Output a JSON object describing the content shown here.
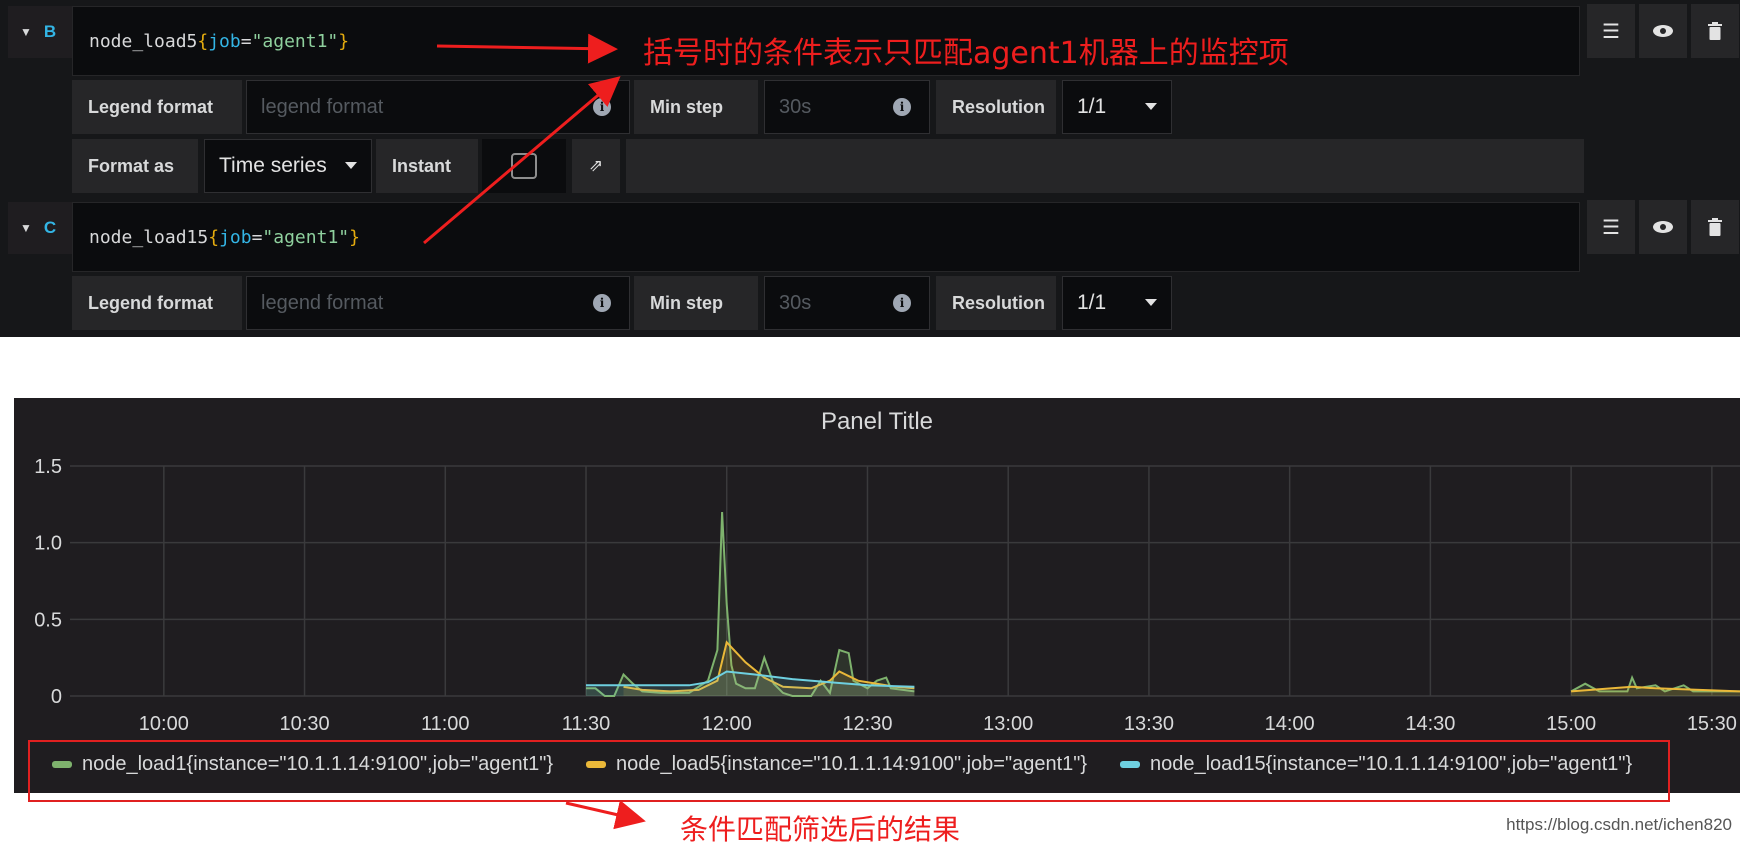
{
  "query_b": {
    "label": "B",
    "expr": {
      "metric": "node_load5",
      "open": "{",
      "key": "job",
      "eq": "=",
      "value": "\"agent1\"",
      "close": "}"
    },
    "legend_format_label": "Legend format",
    "legend_format_placeholder": "legend format",
    "min_step_label": "Min step",
    "min_step_placeholder": "30s",
    "resolution_label": "Resolution",
    "resolution_value": "1/1",
    "format_as_label": "Format as",
    "format_as_value": "Time series",
    "instant_label": "Instant"
  },
  "query_c": {
    "label": "C",
    "expr": {
      "metric": "node_load15",
      "open": "{",
      "key": "job",
      "eq": "=",
      "value": "\"agent1\"",
      "close": "}"
    },
    "legend_format_label": "Legend format",
    "legend_format_placeholder": "legend format",
    "min_step_label": "Min step",
    "min_step_placeholder": "30s",
    "resolution_label": "Resolution",
    "resolution_value": "1/1"
  },
  "icons": {
    "menu": "hamburger-icon",
    "toggle": "eye-icon",
    "remove": "trash-icon",
    "share": "share-icon",
    "info": "info-icon",
    "collapse": "caret-down-icon"
  },
  "annotations": {
    "top": "括号时的条件表示只匹配agent1机器上的监控项",
    "bottom": "条件匹配筛选后的结果"
  },
  "watermark": "https://blog.csdn.net/ichen820",
  "colors": {
    "green": "#7eb26d",
    "yellow": "#eab839",
    "cyan": "#6ed0e0",
    "annotation_red": "#ee1e1e"
  },
  "chart_data": {
    "type": "line",
    "title": "Panel Title",
    "x_ticks": [
      "10:00",
      "10:30",
      "11:00",
      "11:30",
      "12:00",
      "12:30",
      "13:00",
      "13:30",
      "14:00",
      "14:30",
      "15:00",
      "15:30"
    ],
    "y_ticks": [
      "0",
      "0.5",
      "1.0",
      "1.5"
    ],
    "ylim": [
      0,
      1.5
    ],
    "xlim_minutes": [
      580,
      936
    ],
    "grid": true,
    "legend_position": "bottom",
    "series": [
      {
        "name": "node_load1{instance=\"10.1.1.14:9100\",job=\"agent1\"}",
        "color": "#7eb26d",
        "points": [
          [
            690,
            0.05
          ],
          [
            692,
            0.05
          ],
          [
            694,
            0
          ],
          [
            696,
            0
          ],
          [
            698,
            0.14
          ],
          [
            700,
            0.08
          ],
          [
            702,
            0.03
          ],
          [
            706,
            0.02
          ],
          [
            712,
            0.02
          ],
          [
            716,
            0.1
          ],
          [
            718,
            0.3
          ],
          [
            719,
            1.2
          ],
          [
            720,
            0.6
          ],
          [
            721,
            0.2
          ],
          [
            722,
            0.08
          ],
          [
            724,
            0.05
          ],
          [
            726,
            0.05
          ],
          [
            728,
            0.25
          ],
          [
            730,
            0.08
          ],
          [
            732,
            0.02
          ],
          [
            734,
            0.0
          ],
          [
            738,
            0.0
          ],
          [
            740,
            0.1
          ],
          [
            742,
            0.02
          ],
          [
            744,
            0.3
          ],
          [
            746,
            0.28
          ],
          [
            747,
            0.1
          ],
          [
            750,
            0.05
          ],
          [
            752,
            0.1
          ],
          [
            754,
            0.12
          ],
          [
            755,
            0.05
          ],
          [
            760,
            0.03
          ],
          [
            900,
            0.03
          ],
          [
            903,
            0.08
          ],
          [
            906,
            0.03
          ],
          [
            912,
            0.03
          ],
          [
            913,
            0.12
          ],
          [
            914,
            0.05
          ],
          [
            918,
            0.07
          ],
          [
            920,
            0.03
          ],
          [
            924,
            0.07
          ],
          [
            926,
            0.03
          ],
          [
            936,
            0.03
          ]
        ]
      },
      {
        "name": "node_load5{instance=\"10.1.1.14:9100\",job=\"agent1\"}",
        "color": "#eab839",
        "points": [
          [
            698,
            0.06
          ],
          [
            702,
            0.04
          ],
          [
            708,
            0.03
          ],
          [
            714,
            0.04
          ],
          [
            718,
            0.1
          ],
          [
            720,
            0.35
          ],
          [
            724,
            0.22
          ],
          [
            728,
            0.12
          ],
          [
            732,
            0.06
          ],
          [
            738,
            0.05
          ],
          [
            742,
            0.1
          ],
          [
            744,
            0.16
          ],
          [
            748,
            0.1
          ],
          [
            752,
            0.08
          ],
          [
            756,
            0.06
          ],
          [
            760,
            0.05
          ],
          [
            900,
            0.03
          ],
          [
            913,
            0.06
          ],
          [
            918,
            0.05
          ],
          [
            936,
            0.03
          ]
        ]
      },
      {
        "name": "node_load15{instance=\"10.1.1.14:9100\",job=\"agent1\"}",
        "color": "#6ed0e0",
        "points": [
          [
            690,
            0.07
          ],
          [
            696,
            0.07
          ],
          [
            698,
            0.07
          ],
          [
            712,
            0.07
          ],
          [
            716,
            0.09
          ],
          [
            720,
            0.16
          ],
          [
            726,
            0.14
          ],
          [
            734,
            0.11
          ],
          [
            742,
            0.09
          ],
          [
            750,
            0.07
          ],
          [
            760,
            0.06
          ],
          [
            900,
            0.06
          ],
          [
            936,
            0.06
          ]
        ]
      }
    ]
  }
}
